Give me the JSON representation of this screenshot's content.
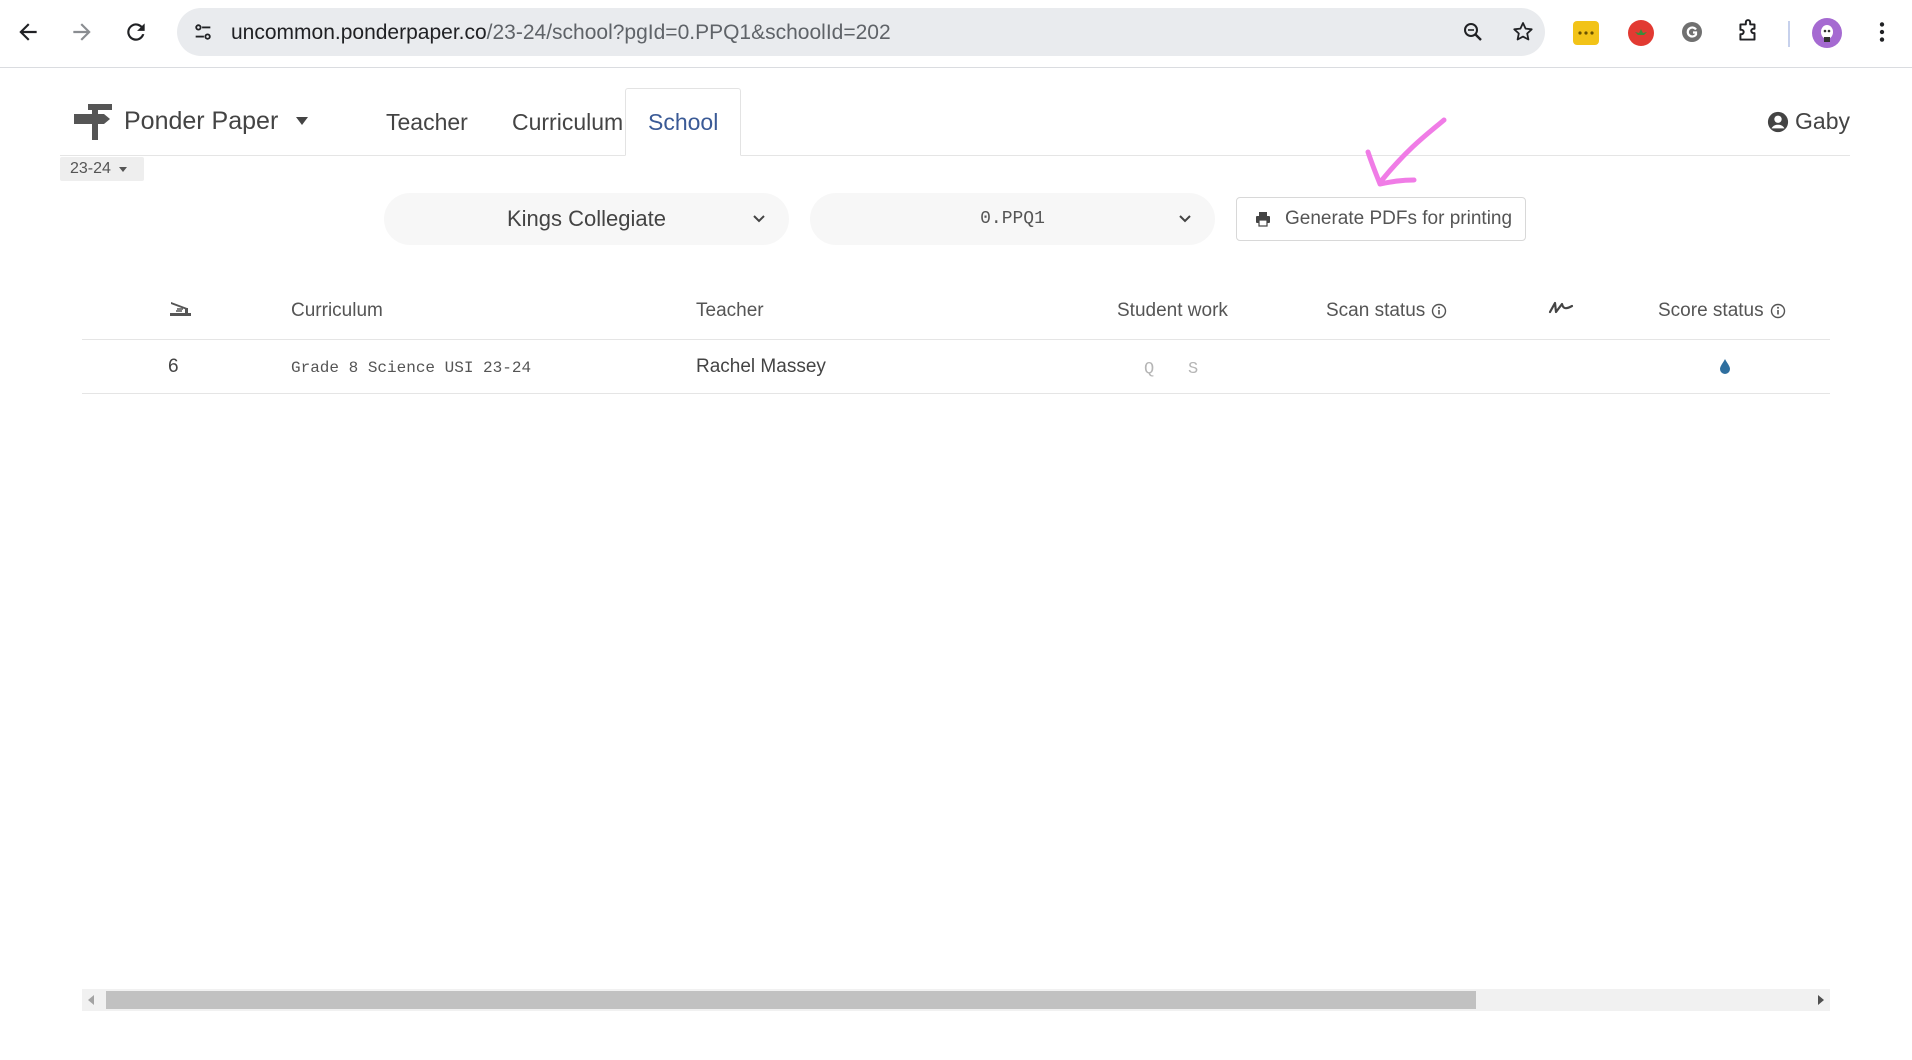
{
  "browser": {
    "url_host": "uncommon.ponderpaper.co",
    "url_path": "/23-24/school?pgId=0.PPQ1&schoolId=202",
    "icons": [
      "back-icon",
      "forward-icon",
      "reload-icon",
      "site-info-icon",
      "zoom-icon",
      "bookmark-star-icon",
      "extension-yellow-icon",
      "extension-tomato-icon",
      "grammarly-icon",
      "extensions-puzzle-icon",
      "profile-avatar",
      "more-menu-icon"
    ]
  },
  "app": {
    "brand": "Ponder Paper",
    "tabs": [
      {
        "label": "Teacher"
      },
      {
        "label": "Curriculum"
      },
      {
        "label": "School"
      }
    ],
    "active_tab": "School",
    "user": "Gaby",
    "year": "23-24"
  },
  "controls": {
    "school_select": "Kings Collegiate",
    "pg_select": "0.PPQ1",
    "generate_button": "Generate PDFs for printing"
  },
  "table": {
    "headers": {
      "stapler": "stapler-icon",
      "curriculum": "Curriculum",
      "teacher": "Teacher",
      "student_work": "Student work",
      "scan_status": "Scan status",
      "signature": "signature-icon",
      "score_status": "Score status"
    },
    "rows": [
      {
        "count": "6",
        "curriculum": "Grade 8 Science USI 23-24",
        "teacher": "Rachel Massey",
        "student_work_q": "Q",
        "student_work_s": "S",
        "score_status_icon": "drop-icon"
      }
    ]
  },
  "colors": {
    "active_tab": "#3a5a96",
    "annotation_arrow": "#f07ce6",
    "score_drop": "#2f6f9f"
  }
}
